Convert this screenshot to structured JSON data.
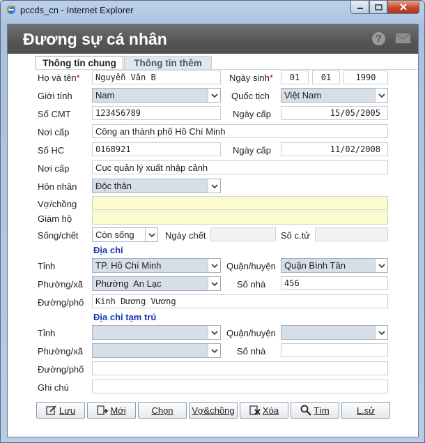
{
  "window": {
    "title": "pccds_cn - Internet Explorer"
  },
  "header": {
    "title": "Đương sự cá nhân"
  },
  "tabs": [
    {
      "label": "Thông tin chung"
    },
    {
      "label": "Thông tin thêm"
    }
  ],
  "labels": {
    "ho_ten": "Họ và tên",
    "ngay_sinh": "Ngày sinh",
    "gioi_tinh": "Giới tính",
    "quoc_tich": "Quốc tịch",
    "so_cmt": "Số CMT",
    "ngay_cap": "Ngày cấp",
    "noi_cap": "Nơi cấp",
    "so_hc": "Số HC",
    "ngay_cap2": "Ngày cấp",
    "noi_cap2": "Nơi cấp",
    "hon_nhan": "Hôn nhân",
    "vo_chong": "Vợ/chồng",
    "giam_ho": "Giám hộ",
    "song_chet": "Sống/chết",
    "ngay_chet": "Ngày chết",
    "so_ctu": "Số c.tử",
    "tinh": "Tỉnh",
    "quan_huyen": "Quận/huyện",
    "phuong_xa": "Phường/xã",
    "so_nha": "Số nhà",
    "duong_pho": "Đường/phố",
    "tinh2": "Tỉnh",
    "quan_huyen2": "Quận/huyện",
    "phuong_xa2": "Phường/xã",
    "so_nha2": "Số nhà",
    "duong_pho2": "Đường/phố",
    "ghi_chu": "Ghi chú",
    "required_mark": "*"
  },
  "sections": {
    "dia_chi": "Địa chỉ",
    "dia_chi_tam_tru": "Địa chỉ tạm trú"
  },
  "values": {
    "ho_ten": "Nguyễn Văn B",
    "ngay_sinh_d": "01",
    "ngay_sinh_m": "01",
    "ngay_sinh_y": "1990",
    "gioi_tinh": "Nam",
    "quoc_tich": "Việt Nam",
    "so_cmt": "123456789",
    "ngay_cap": "15/05/2005",
    "noi_cap": "Công an thành phố Hồ Chí Minh",
    "so_hc": "0168921",
    "ngay_cap2": "11/02/2008",
    "noi_cap2": "Cục quản lý xuất nhập cảnh",
    "hon_nhan": "Độc thân",
    "vo_chong": "",
    "giam_ho": "",
    "song_chet": "Còn sống",
    "ngay_chet": "",
    "so_ctu": "",
    "tinh": "TP. Hồ Chí Minh",
    "quan_huyen": "Quận Bình Tân",
    "phuong_xa": "Phường  An Lạc",
    "so_nha": "456",
    "duong_pho": "Kinh Dương Vương",
    "tinh2": "",
    "quan_huyen2": "",
    "phuong_xa2": "",
    "so_nha2": "",
    "duong_pho2": "",
    "ghi_chu": ""
  },
  "buttons": {
    "luu": "Lưu",
    "moi": "Mới",
    "chon": "Chọn",
    "vo_chong": "Vợ&chồng",
    "xoa": "Xóa",
    "tim": "Tìm",
    "lsu": "L.sử"
  },
  "icons": {
    "ie": "internet-explorer-icon",
    "help": "help-icon",
    "mail": "mail-icon",
    "save": "edit-icon",
    "new": "add-icon",
    "delete": "delete-icon",
    "search": "search-icon"
  },
  "colors": {
    "header_bg": "#555555",
    "section_text": "#1638b0",
    "required": "#cc0000",
    "yellow_field": "#fbfad0"
  }
}
